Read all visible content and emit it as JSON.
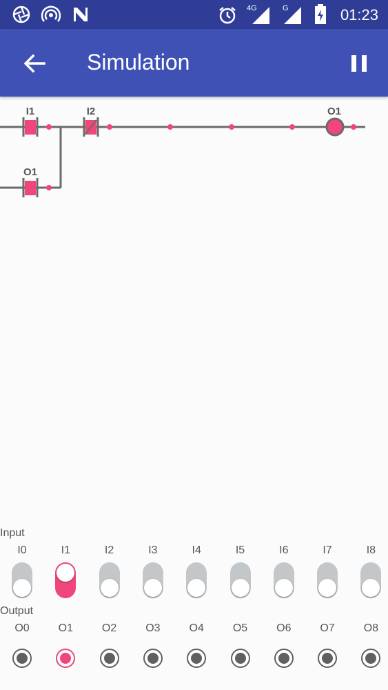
{
  "status_bar": {
    "icons": [
      "aperture-icon",
      "wifi-hotspot-icon",
      "n-logo-icon",
      "alarm-icon",
      "signal-4g-icon",
      "signal-g-icon",
      "battery-charging-icon"
    ],
    "network1": "4G",
    "network2": "G",
    "time": "01:23"
  },
  "app_bar": {
    "title": "Simulation",
    "back_icon": "arrow-left-icon",
    "pause_icon": "pause-icon",
    "color": "#3f51b5"
  },
  "ladder": {
    "rung1": {
      "contact1": "I1",
      "contact2": "I2",
      "coil": "O1"
    },
    "rung2": {
      "contact1": "O1"
    },
    "accent": "#f0467a",
    "wire_color": "#6a6a6a"
  },
  "input": {
    "label": "Input",
    "channels": [
      {
        "name": "I0",
        "on": false
      },
      {
        "name": "I1",
        "on": true
      },
      {
        "name": "I2",
        "on": false
      },
      {
        "name": "I3",
        "on": false
      },
      {
        "name": "I4",
        "on": false
      },
      {
        "name": "I5",
        "on": false
      },
      {
        "name": "I6",
        "on": false
      },
      {
        "name": "I7",
        "on": false
      },
      {
        "name": "I8",
        "on": false
      }
    ]
  },
  "output": {
    "label": "Output",
    "channels": [
      {
        "name": "O0",
        "on": false
      },
      {
        "name": "O1",
        "on": true
      },
      {
        "name": "O2",
        "on": false
      },
      {
        "name": "O3",
        "on": false
      },
      {
        "name": "O4",
        "on": false
      },
      {
        "name": "O5",
        "on": false
      },
      {
        "name": "O6",
        "on": false
      },
      {
        "name": "O7",
        "on": false
      },
      {
        "name": "O8",
        "on": false
      }
    ]
  }
}
